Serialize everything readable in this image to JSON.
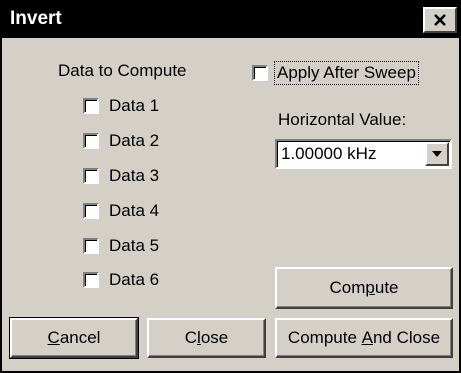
{
  "window": {
    "title": "Invert",
    "close_icon": "close-icon"
  },
  "data_group": {
    "heading": "Data to Compute",
    "items": [
      {
        "label": "Data 1",
        "checked": false
      },
      {
        "label": "Data 2",
        "checked": false
      },
      {
        "label": "Data 3",
        "checked": false
      },
      {
        "label": "Data 4",
        "checked": false
      },
      {
        "label": "Data 5",
        "checked": false
      },
      {
        "label": "Data 6",
        "checked": false
      }
    ]
  },
  "apply_after_sweep": {
    "label": "Apply After Sweep",
    "checked": false
  },
  "horizontal_value": {
    "label": "Horizontal Value:",
    "value": "1.00000 kHz"
  },
  "buttons": {
    "compute": {
      "before": "Com",
      "mnemonic": "p",
      "after": "ute"
    },
    "cancel": {
      "before": "",
      "mnemonic": "C",
      "after": "ancel"
    },
    "close": {
      "before": "C",
      "mnemonic": "l",
      "after": "ose"
    },
    "compute_and_close": {
      "before": "Compute ",
      "mnemonic": "A",
      "after": "nd Close"
    }
  }
}
